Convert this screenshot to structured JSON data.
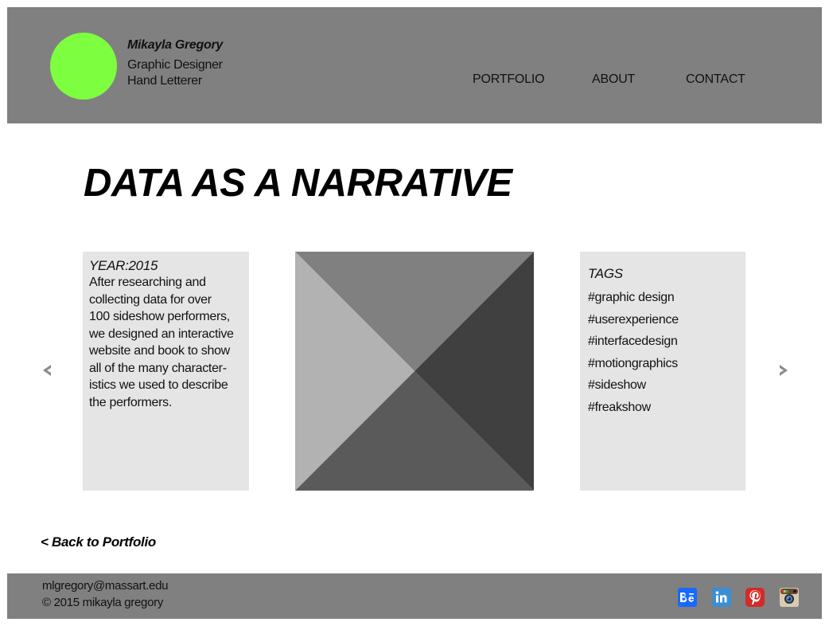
{
  "header": {
    "brand_name": "Mikayla Gregory",
    "role_1": "Graphic Designer",
    "role_2": "Hand Letterer",
    "logo_color": "#7dff40",
    "nav": [
      "PORTFOLIO",
      "ABOUT",
      "CONTACT"
    ]
  },
  "main": {
    "title": "DATA AS A NARRATIVE",
    "year": "YEAR:2015",
    "description": "After researching and\ncollecting data for over\n100 sideshow performers,\nwe designed an interactive\nwebsite and book to show\nall of the many character-\nistics we used to describe\nthe performers.",
    "tags_heading": "TAGS",
    "tags": [
      "#graphic design",
      "#userexperience",
      "#interfacedesign",
      "#motiongraphics",
      "#sideshow",
      "#freakshow"
    ],
    "prev_icon": "chevron-left-icon",
    "next_icon": "chevron-right-icon",
    "back_link": "< Back to Portfolio"
  },
  "footer": {
    "email": "mlgregory@massart.edu",
    "copyright": "© 2015 mikayla gregory",
    "social": [
      "behance-icon",
      "linkedin-icon",
      "pinterest-icon",
      "instagram-icon"
    ]
  },
  "colors": {
    "header_bg": "#808080",
    "panel_bg": "#e5e5e5",
    "accent": "#7dff40"
  }
}
